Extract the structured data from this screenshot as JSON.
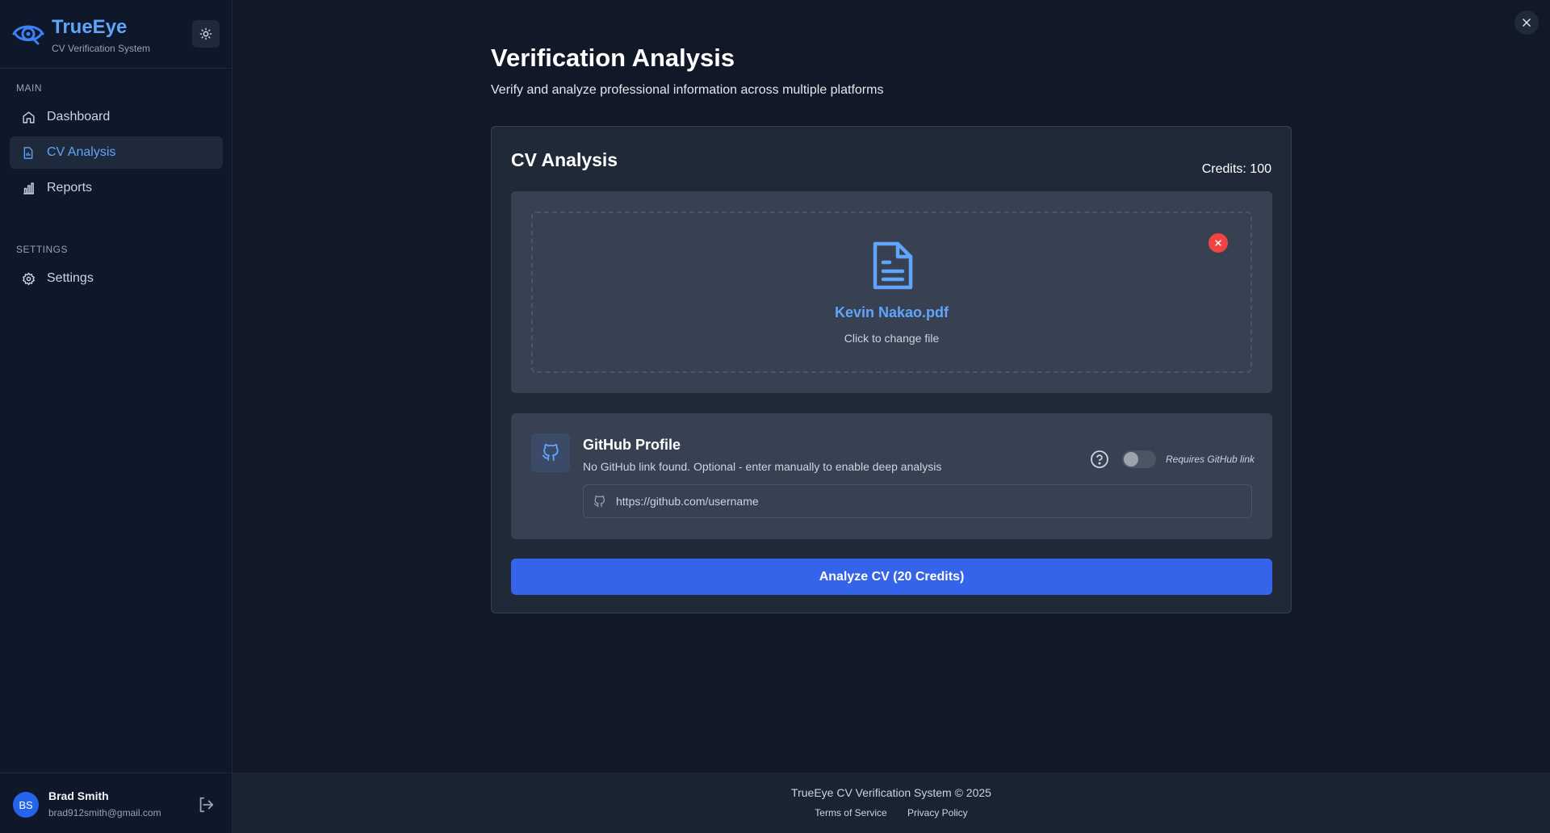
{
  "brand": {
    "title": "TrueEye",
    "subtitle": "CV Verification System",
    "logo_icon": "eye-icon",
    "theme_icon": "sun-icon"
  },
  "sidebar": {
    "sections": [
      {
        "label": "MAIN",
        "items": [
          {
            "label": "Dashboard",
            "icon": "home-icon",
            "active": false
          },
          {
            "label": "CV Analysis",
            "icon": "file-chart-icon",
            "active": true
          },
          {
            "label": "Reports",
            "icon": "bar-chart-icon",
            "active": false
          }
        ]
      },
      {
        "label": "SETTINGS",
        "items": [
          {
            "label": "Settings",
            "icon": "gear-icon",
            "active": false
          }
        ]
      }
    ]
  },
  "user": {
    "initials": "BS",
    "name": "Brad Smith",
    "email": "brad912smith@gmail.com",
    "logout_icon": "logout-icon"
  },
  "page": {
    "title": "Verification Analysis",
    "subtitle": "Verify and analyze professional information across multiple platforms"
  },
  "card": {
    "title": "CV Analysis",
    "credits": "Credits: 100",
    "upload": {
      "file_name": "Kevin Nakao.pdf",
      "hint": "Click to change file"
    },
    "github": {
      "title": "GitHub Profile",
      "description": "No GitHub link found. Optional - enter manually to enable deep analysis",
      "toggle_label": "Requires GitHub link",
      "toggle_on": false,
      "input_placeholder": "https://github.com/username",
      "input_value": ""
    },
    "analyze_button": "Analyze CV (20 Credits)"
  },
  "footer": {
    "copyright": "TrueEye CV Verification System © 2025",
    "links": [
      "Terms of Service",
      "Privacy Policy"
    ]
  },
  "colors": {
    "background": "#111827",
    "sidebar": "#0f172a",
    "accent": "#60a5fa",
    "primary_button": "#3563e9",
    "danger": "#ef4444"
  }
}
